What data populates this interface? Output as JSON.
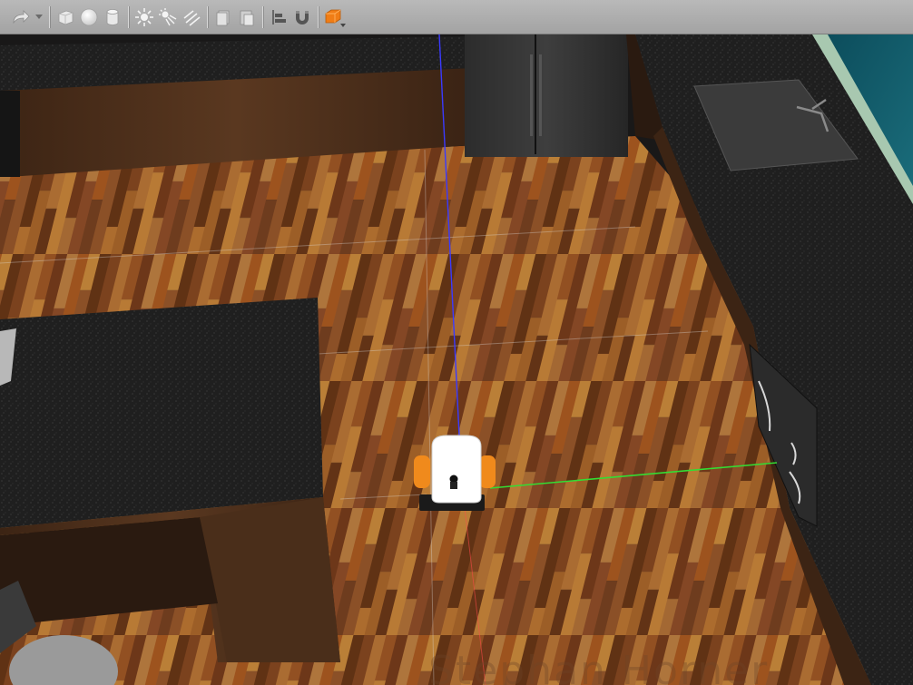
{
  "toolbar": {
    "items": [
      {
        "name": "redo-icon",
        "kind": "button"
      },
      {
        "name": "redo-dropdown-icon",
        "kind": "caret"
      },
      {
        "name": "separator"
      },
      {
        "name": "box-shape-icon",
        "kind": "button"
      },
      {
        "name": "sphere-shape-icon",
        "kind": "button"
      },
      {
        "name": "cylinder-shape-icon",
        "kind": "button"
      },
      {
        "name": "separator"
      },
      {
        "name": "point-light-icon",
        "kind": "button"
      },
      {
        "name": "spot-light-icon",
        "kind": "button"
      },
      {
        "name": "directional-light-icon",
        "kind": "button"
      },
      {
        "name": "separator"
      },
      {
        "name": "copy-icon",
        "kind": "button"
      },
      {
        "name": "paste-icon",
        "kind": "button"
      },
      {
        "name": "separator"
      },
      {
        "name": "align-icon",
        "kind": "button"
      },
      {
        "name": "snap-magnet-icon",
        "kind": "button"
      },
      {
        "name": "separator"
      },
      {
        "name": "view-angle-icon",
        "kind": "button"
      }
    ],
    "accent_color": "#f07d16"
  },
  "viewport": {
    "axis_colors": {
      "x": "#ff4a4a",
      "y": "#33dd33",
      "z": "#3a3aff"
    },
    "watermark": "Stephan Horner",
    "robot_wheel_color": "#f08a1c",
    "robot_body_color": "#ffffff"
  }
}
